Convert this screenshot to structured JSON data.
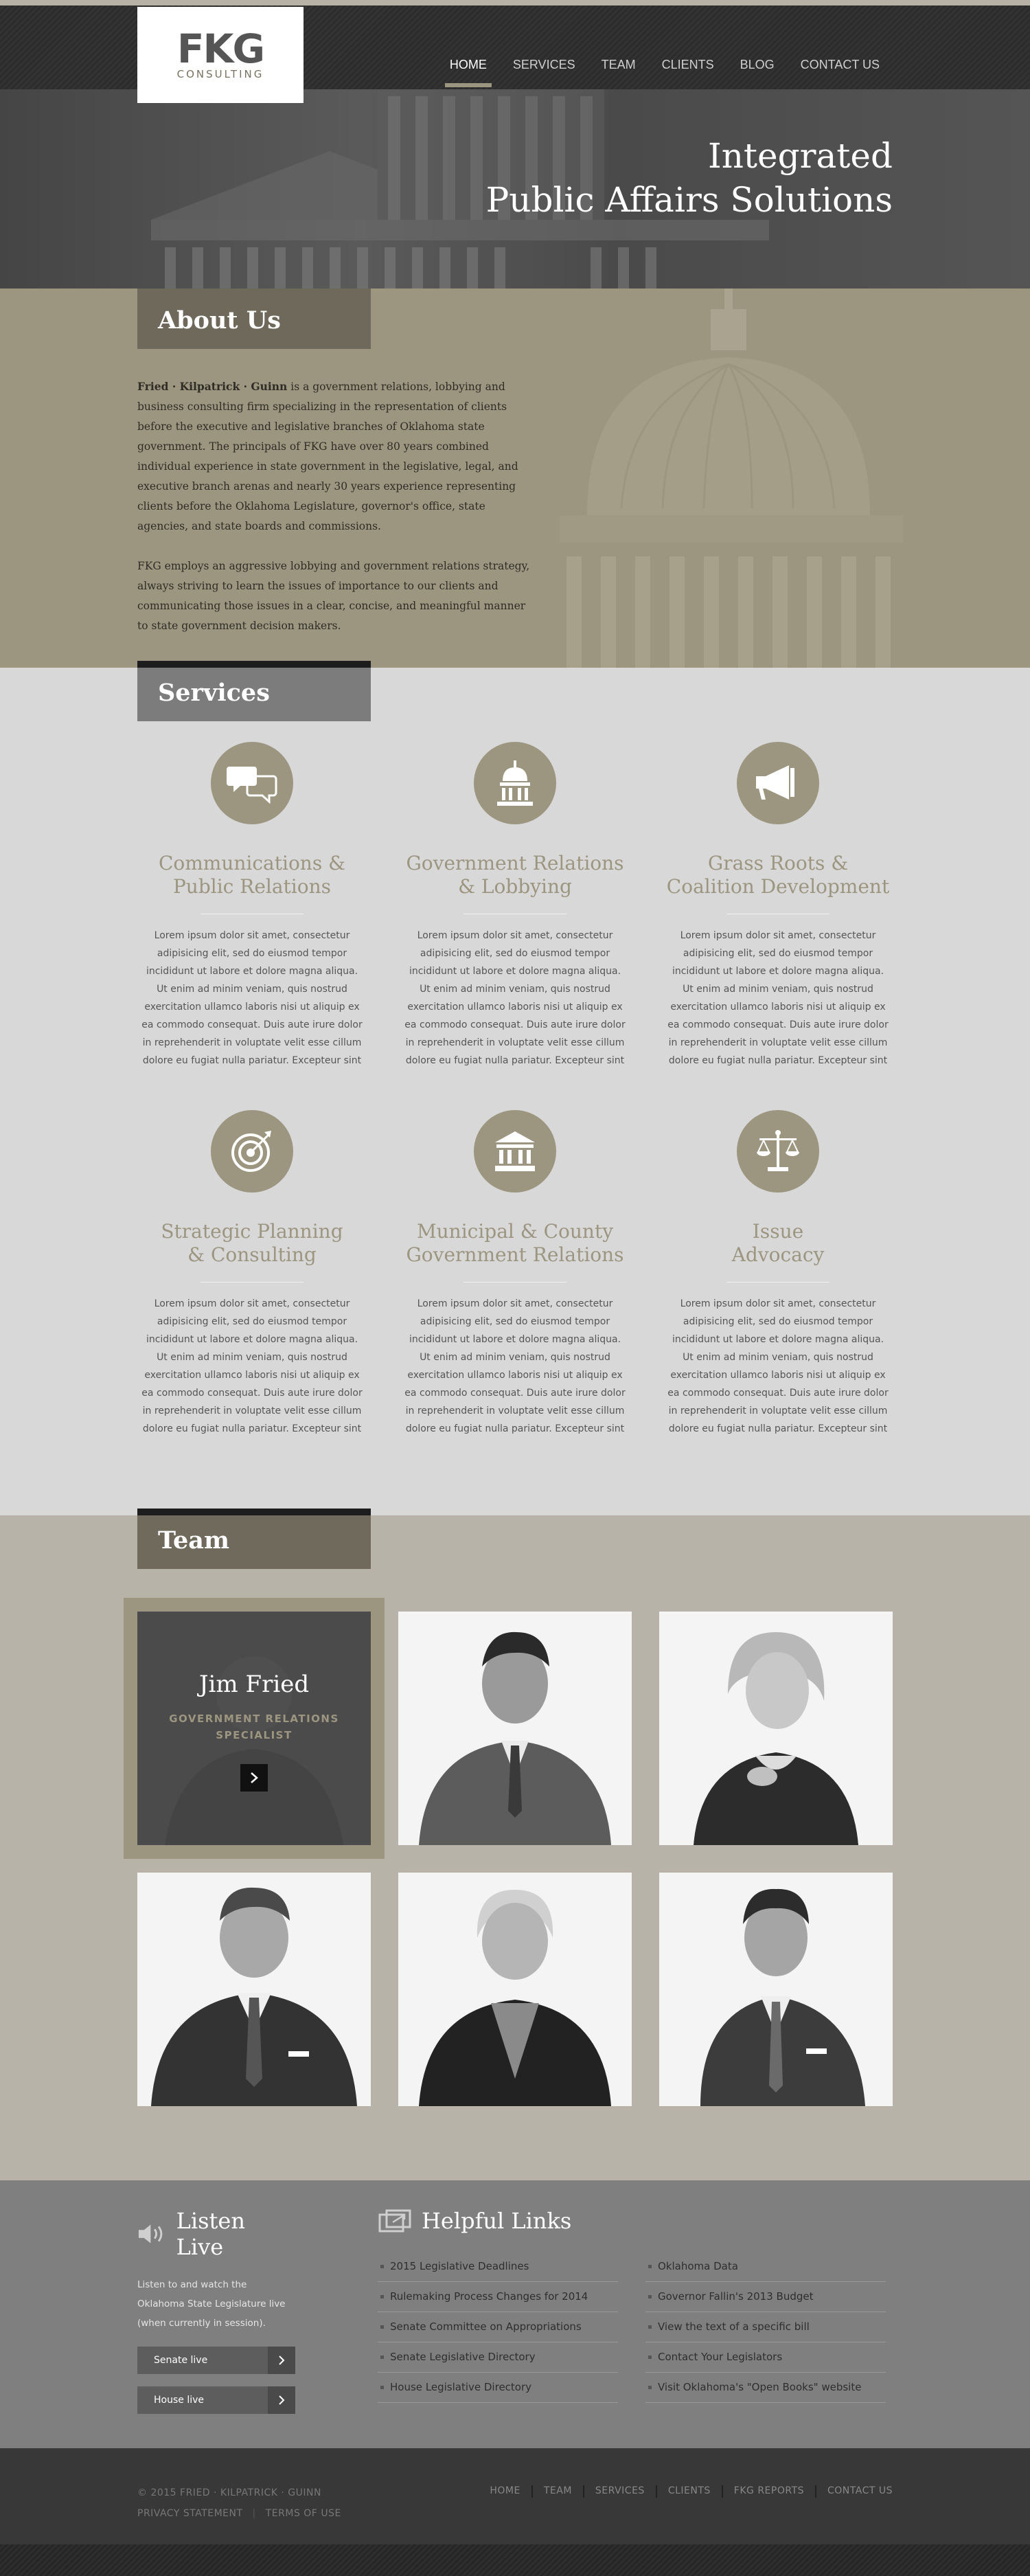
{
  "brand": {
    "logo_text": "FKG",
    "logo_sub": "CONSULTING"
  },
  "nav": {
    "items": [
      {
        "label": "HOME",
        "active": true
      },
      {
        "label": "SERVICES"
      },
      {
        "label": "TEAM"
      },
      {
        "label": "CLIENTS"
      },
      {
        "label": "BLOG"
      },
      {
        "label": "CONTACT US"
      }
    ]
  },
  "hero": {
    "line1": "Integrated",
    "line2": "Public Affairs Solutions"
  },
  "about": {
    "heading": "About Us",
    "p1_bold": "Fried · Kilpatrick · Guinn",
    "p1": " is a government relations, lobbying and business consulting firm specializing in the representation of clients before the executive and legislative branches of Oklahoma state government. The principals of FKG have over 80 years combined individual experience in state government in the legislative, legal, and executive branch arenas and nearly 30 years experience representing clients before the Oklahoma Legislature, governor's office, state agencies, and state boards and commissions.",
    "p2": "FKG employs an aggressive lobbying and government relations strategy, always striving to learn the issues of importance to our clients and communicating those issues in a clear, concise, and meaningful manner to state government decision makers."
  },
  "services": {
    "heading": "Services",
    "items": [
      {
        "line1": "Communications &",
        "line2": "Public Relations",
        "icon": "speech-bubbles-icon",
        "text": "Lorem ipsum dolor sit amet, consectetur adipisicing elit, sed do eiusmod tempor incididunt ut labore et dolore magna aliqua. Ut enim ad minim veniam, quis nostrud exercitation ullamco laboris nisi ut aliquip ex ea commodo consequat. Duis aute irure dolor in reprehenderit in voluptate velit esse cillum dolore eu fugiat nulla pariatur. Excepteur sint"
      },
      {
        "line1": "Government Relations",
        "line2": "& Lobbying",
        "icon": "capitol-icon",
        "text": "Lorem ipsum dolor sit amet, consectetur adipisicing elit, sed do eiusmod tempor incididunt ut labore et dolore magna aliqua. Ut enim ad minim veniam, quis nostrud exercitation ullamco laboris nisi ut aliquip ex ea commodo consequat. Duis aute irure dolor in reprehenderit in voluptate velit esse cillum dolore eu fugiat nulla pariatur. Excepteur sint"
      },
      {
        "line1": "Grass Roots &",
        "line2": "Coalition Development",
        "icon": "megaphone-icon",
        "text": "Lorem ipsum dolor sit amet, consectetur adipisicing elit, sed do eiusmod tempor incididunt ut labore et dolore magna aliqua. Ut enim ad minim veniam, quis nostrud exercitation ullamco laboris nisi ut aliquip ex ea commodo consequat. Duis aute irure dolor in reprehenderit in voluptate velit esse cillum dolore eu fugiat nulla pariatur. Excepteur sint"
      },
      {
        "line1": "Strategic Planning",
        "line2": "& Consulting",
        "icon": "target-icon",
        "text": "Lorem ipsum dolor sit amet, consectetur adipisicing elit, sed do eiusmod tempor incididunt ut labore et dolore magna aliqua. Ut enim ad minim veniam, quis nostrud exercitation ullamco laboris nisi ut aliquip ex ea commodo consequat. Duis aute irure dolor in reprehenderit in voluptate velit esse cillum dolore eu fugiat nulla pariatur. Excepteur sint"
      },
      {
        "line1": "Municipal & County",
        "line2": "Government Relations",
        "icon": "courthouse-icon",
        "text": "Lorem ipsum dolor sit amet, consectetur adipisicing elit, sed do eiusmod tempor incididunt ut labore et dolore magna aliqua. Ut enim ad minim veniam, quis nostrud exercitation ullamco laboris nisi ut aliquip ex ea commodo consequat. Duis aute irure dolor in reprehenderit in voluptate velit esse cillum dolore eu fugiat nulla pariatur. Excepteur sint"
      },
      {
        "line1": "Issue",
        "line2": "Advocacy",
        "icon": "scales-icon",
        "text": "Lorem ipsum dolor sit amet, consectetur adipisicing elit, sed do eiusmod tempor incididunt ut labore et dolore magna aliqua. Ut enim ad minim veniam, quis nostrud exercitation ullamco laboris nisi ut aliquip ex ea commodo consequat. Duis aute irure dolor in reprehenderit in voluptate velit esse cillum dolore eu fugiat nulla pariatur. Excepteur sint"
      }
    ]
  },
  "team": {
    "heading": "Team",
    "featured": {
      "name": "Jim Fried",
      "role_line1": "GOVERNMENT RELATIONS",
      "role_line2": "SPECIALIST"
    }
  },
  "listen": {
    "heading": "Listen Live",
    "text": "Listen to and watch the Oklahoma State Legislature live (when currently in session).",
    "senate_label": "Senate live",
    "house_label": "House live"
  },
  "helpful": {
    "heading": "Helpful Links",
    "left": [
      "2015 Legislative Deadlines",
      "Rulemaking Process Changes for 2014",
      "Senate Committee on Appropriations",
      "Senate Legislative Directory",
      "House Legislative Directory"
    ],
    "right": [
      "Oklahoma Data",
      "Governor Fallin's 2013 Budget",
      "View the text of a specific bill",
      "Contact Your Legislators",
      "Visit Oklahoma's \"Open Books\" website"
    ]
  },
  "footer": {
    "copyright": "© 2015  FRIED · KILPATRICK · GUINN",
    "privacy": "PRIVACY STATEMENT",
    "terms": "TERMS OF USE",
    "nav": [
      "HOME",
      "TEAM",
      "SERVICES",
      "CLIENTS",
      "FKG REPORTS",
      "CONTACT US"
    ]
  },
  "colors": {
    "accent": "#9c9580",
    "services_bg": "#d8d8d8",
    "team_bg": "#b8b3a8"
  }
}
